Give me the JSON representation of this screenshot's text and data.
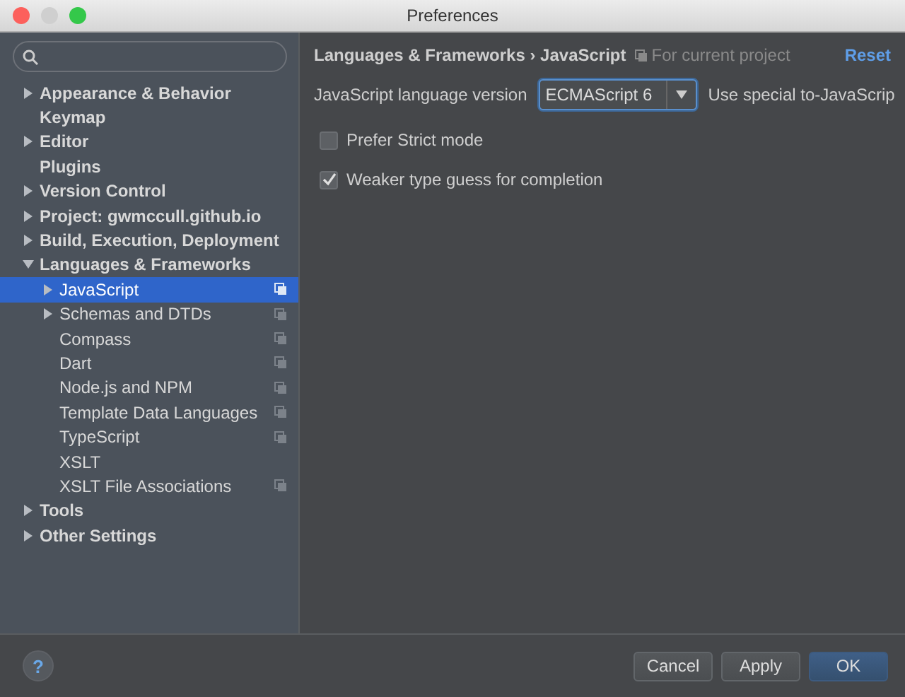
{
  "window": {
    "title": "Preferences"
  },
  "tree": [
    {
      "label": "Appearance & Behavior",
      "expandable": true,
      "expanded": false,
      "selected": false,
      "project_scope": false
    },
    {
      "label": "Keymap",
      "expandable": false,
      "expanded": false,
      "selected": false,
      "project_scope": false
    },
    {
      "label": "Editor",
      "expandable": true,
      "expanded": false,
      "selected": false,
      "project_scope": false
    },
    {
      "label": "Plugins",
      "expandable": false,
      "expanded": false,
      "selected": false,
      "project_scope": false
    },
    {
      "label": "Version Control",
      "expandable": true,
      "expanded": false,
      "selected": false,
      "project_scope": false
    },
    {
      "label": "Project: gwmccull.github.io",
      "expandable": true,
      "expanded": false,
      "selected": false,
      "project_scope": false
    },
    {
      "label": "Build, Execution, Deployment",
      "expandable": true,
      "expanded": false,
      "selected": false,
      "project_scope": false
    },
    {
      "label": "Languages & Frameworks",
      "expandable": true,
      "expanded": true,
      "selected": false,
      "project_scope": false,
      "children": [
        {
          "label": "JavaScript",
          "expandable": true,
          "expanded": false,
          "selected": true,
          "project_scope": true
        },
        {
          "label": "Schemas and DTDs",
          "expandable": true,
          "expanded": false,
          "selected": false,
          "project_scope": true
        },
        {
          "label": "Compass",
          "expandable": false,
          "expanded": false,
          "selected": false,
          "project_scope": true
        },
        {
          "label": "Dart",
          "expandable": false,
          "expanded": false,
          "selected": false,
          "project_scope": true
        },
        {
          "label": "Node.js and NPM",
          "expandable": false,
          "expanded": false,
          "selected": false,
          "project_scope": true
        },
        {
          "label": "Template Data Languages",
          "expandable": false,
          "expanded": false,
          "selected": false,
          "project_scope": true
        },
        {
          "label": "TypeScript",
          "expandable": false,
          "expanded": false,
          "selected": false,
          "project_scope": true
        },
        {
          "label": "XSLT",
          "expandable": false,
          "expanded": false,
          "selected": false,
          "project_scope": false
        },
        {
          "label": "XSLT File Associations",
          "expandable": false,
          "expanded": false,
          "selected": false,
          "project_scope": true
        }
      ]
    },
    {
      "label": "Tools",
      "expandable": true,
      "expanded": false,
      "selected": false,
      "project_scope": false
    },
    {
      "label": "Other Settings",
      "expandable": true,
      "expanded": false,
      "selected": false,
      "project_scope": false
    }
  ],
  "breadcrumb": {
    "path": "Languages & Frameworks › JavaScript",
    "scope": "For current project",
    "reset": "Reset"
  },
  "language_version": {
    "label": "JavaScript language version",
    "value": "ECMAScript 6",
    "note": "Use special to-JavaScrip"
  },
  "options": [
    {
      "label": "Prefer Strict mode",
      "checked": false
    },
    {
      "label": "Weaker type guess for completion",
      "checked": true
    }
  ],
  "buttons": [
    {
      "label": "Cancel",
      "kind": "normal"
    },
    {
      "label": "Apply",
      "kind": "normal"
    },
    {
      "label": "OK",
      "kind": "default"
    }
  ],
  "help": "?"
}
